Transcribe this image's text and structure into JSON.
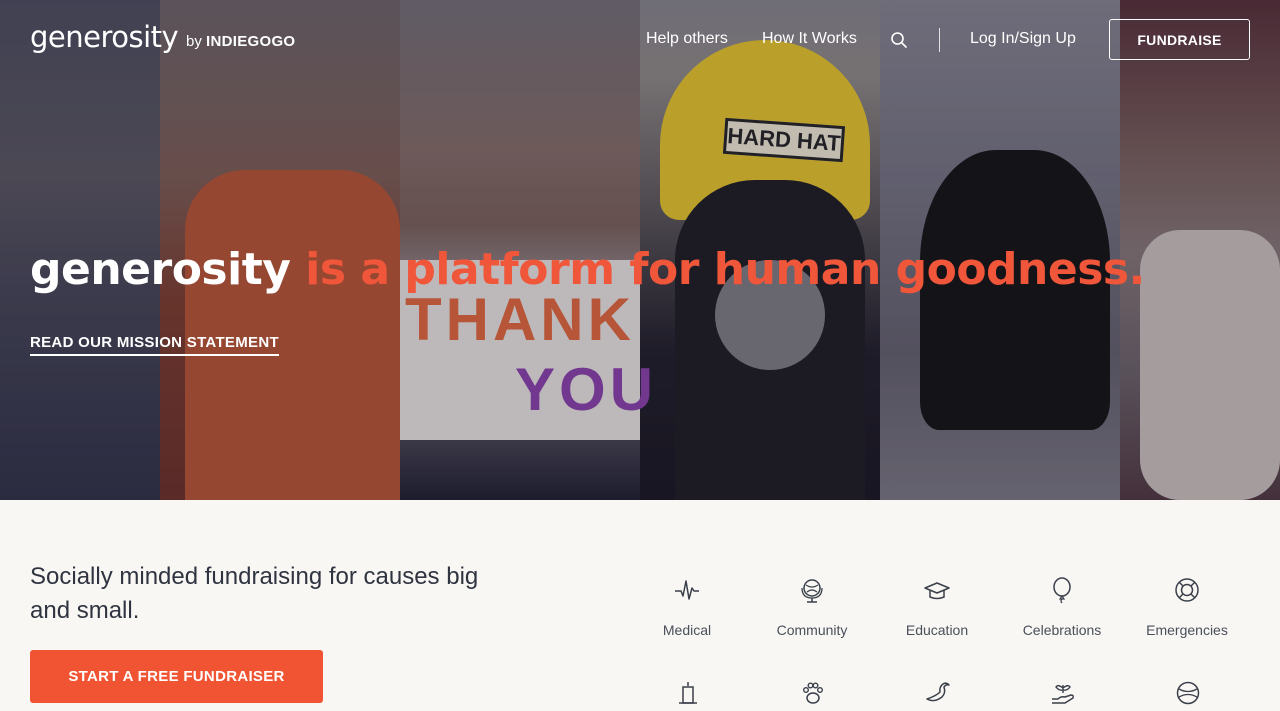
{
  "brand": {
    "logo": "generosity",
    "by": "by",
    "by_brand": "INDIEGOGO"
  },
  "nav": {
    "help_others": "Help others",
    "how_it_works": "How It Works",
    "login": "Log In/Sign Up",
    "fundraise": "FUNDRAISE"
  },
  "hero": {
    "headline_white": "generosity",
    "headline_orange": " is a platform for human goodness.",
    "mission_link": "READ OUR MISSION STATEMENT",
    "helmet_text": "HARD HAT",
    "sign_line1": "THANK",
    "sign_line2": "YOU"
  },
  "lower": {
    "tagline": "Socially minded fundraising for causes big and small.",
    "cta": "START A FREE FUNDRAISER"
  },
  "categories": [
    {
      "label": "Medical",
      "icon": "heartbeat-icon"
    },
    {
      "label": "Community",
      "icon": "globe-icon"
    },
    {
      "label": "Education",
      "icon": "graduation-cap-icon"
    },
    {
      "label": "Celebrations",
      "icon": "balloon-icon"
    },
    {
      "label": "Emergencies",
      "icon": "lifebuoy-icon"
    }
  ],
  "categories_row2_icons": [
    "candle-icon",
    "paw-icon",
    "bird-icon",
    "hand-plant-icon",
    "ball-icon"
  ],
  "colors": {
    "accent": "#f0563a",
    "cta": "#f05433",
    "text": "#2f3440",
    "background": "#f8f7f4"
  }
}
